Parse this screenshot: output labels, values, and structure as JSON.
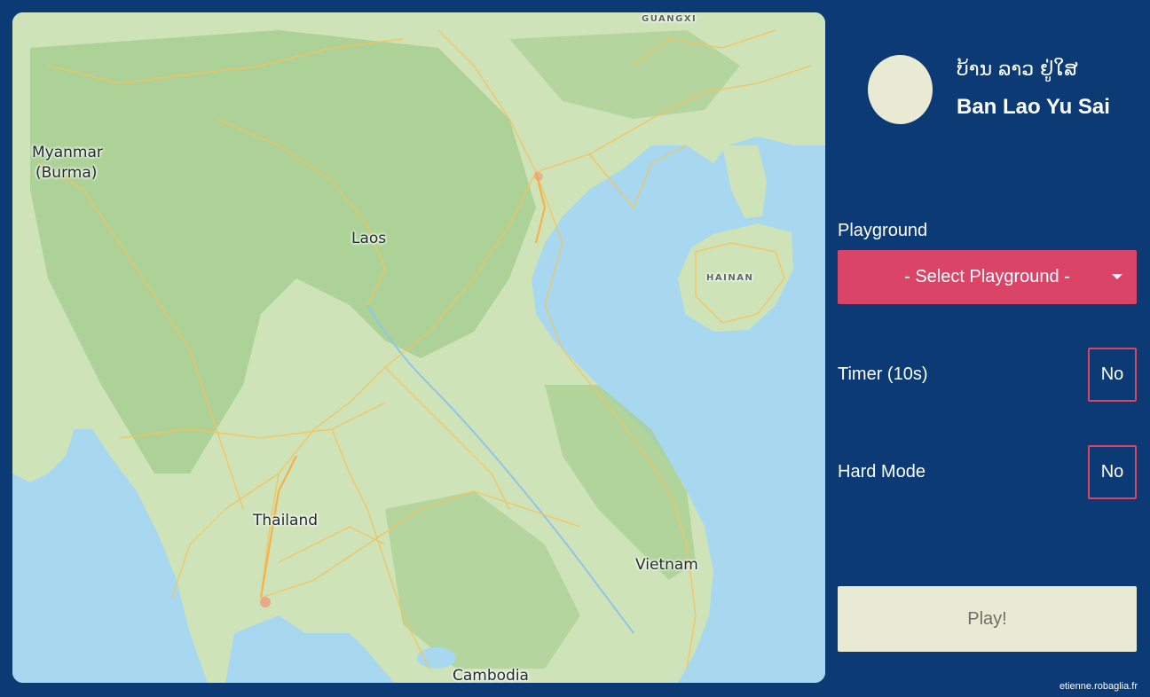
{
  "map": {
    "labels": {
      "guangxi": "GUANGXI",
      "myanmar": "Myanmar",
      "burma": "(Burma)",
      "laos": "Laos",
      "hainan": "HAINAN",
      "thailand": "Thailand",
      "vietnam": "Vietnam",
      "cambodia": "Cambodia"
    },
    "colors": {
      "water": "#a8d8f0",
      "land": "#cfe3b9",
      "forest": "#a9cf94",
      "roads": "#f5c35a"
    }
  },
  "header": {
    "title_lao": "ບ້ານ ລາວ ຢູ່ໃສ",
    "title_latin": "Ban Lao Yu Sai"
  },
  "settings": {
    "playground_label": "Playground",
    "playground_select": "- Select Playground -",
    "timer_label": "Timer (10s)",
    "timer_value": "No",
    "hard_mode_label": "Hard Mode",
    "hard_mode_value": "No"
  },
  "actions": {
    "play_label": "Play!"
  },
  "footer": {
    "credit": "etienne.robaglia.fr"
  },
  "colors": {
    "background": "#0b3a75",
    "accent": "#d94467",
    "cream": "#e9ead3"
  }
}
